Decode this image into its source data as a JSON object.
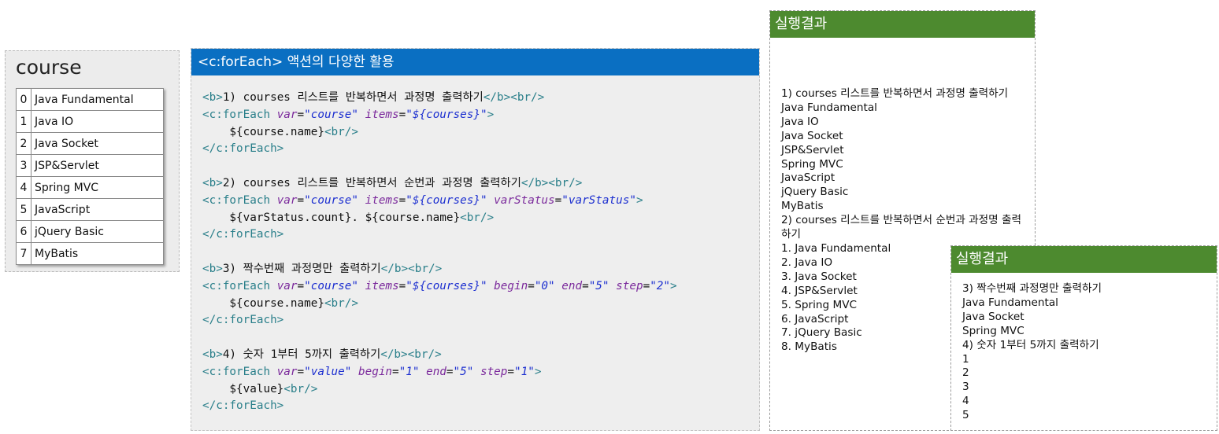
{
  "course_panel": {
    "title": "course",
    "rows": [
      {
        "index": "0",
        "name": "Java Fundamental"
      },
      {
        "index": "1",
        "name": "Java IO"
      },
      {
        "index": "2",
        "name": "Java Socket"
      },
      {
        "index": "3",
        "name": "JSP&Servlet"
      },
      {
        "index": "4",
        "name": "Spring MVC"
      },
      {
        "index": "5",
        "name": "JavaScript"
      },
      {
        "index": "6",
        "name": "jQuery Basic"
      },
      {
        "index": "7",
        "name": "MyBatis"
      }
    ]
  },
  "code_panel": {
    "title": "<c:forEach> 액션의 다양한 활용",
    "lines": [
      [
        [
          "tg",
          "<b>"
        ],
        [
          "tx",
          "1) courses 리스트를 반복하면서 과정명 출력하기"
        ],
        [
          "tg",
          "</b><br/>"
        ]
      ],
      [
        [
          "kw",
          "<c:forEach "
        ],
        [
          "at",
          "var"
        ],
        [
          "tx",
          "="
        ],
        [
          "vl",
          "\"course\""
        ],
        [
          "tx",
          " "
        ],
        [
          "at",
          "items"
        ],
        [
          "tx",
          "="
        ],
        [
          "vl",
          "\"${courses}\""
        ],
        [
          "kw",
          ">"
        ]
      ],
      [
        [
          "tx",
          "    ${course.name}"
        ],
        [
          "tg",
          "<br/>"
        ]
      ],
      [
        [
          "kw",
          "</c:forEach>"
        ]
      ],
      [],
      [
        [
          "tg",
          "<b>"
        ],
        [
          "tx",
          "2) courses 리스트를 반복하면서 순번과 과정명 출력하기"
        ],
        [
          "tg",
          "</b><br/>"
        ]
      ],
      [
        [
          "kw",
          "<c:forEach "
        ],
        [
          "at",
          "var"
        ],
        [
          "tx",
          "="
        ],
        [
          "vl",
          "\"course\""
        ],
        [
          "tx",
          " "
        ],
        [
          "at",
          "items"
        ],
        [
          "tx",
          "="
        ],
        [
          "vl",
          "\"${courses}\""
        ],
        [
          "tx",
          " "
        ],
        [
          "at",
          "varStatus"
        ],
        [
          "tx",
          "="
        ],
        [
          "vl",
          "\"varStatus\""
        ],
        [
          "kw",
          ">"
        ]
      ],
      [
        [
          "tx",
          "    ${varStatus.count}. ${course.name}"
        ],
        [
          "tg",
          "<br/>"
        ]
      ],
      [
        [
          "kw",
          "</c:forEach>"
        ]
      ],
      [],
      [
        [
          "tg",
          "<b>"
        ],
        [
          "tx",
          "3) 짝수번째 과정명만 출력하기"
        ],
        [
          "tg",
          "</b><br/>"
        ]
      ],
      [
        [
          "kw",
          "<c:forEach "
        ],
        [
          "at",
          "var"
        ],
        [
          "tx",
          "="
        ],
        [
          "vl",
          "\"course\""
        ],
        [
          "tx",
          " "
        ],
        [
          "at",
          "items"
        ],
        [
          "tx",
          "="
        ],
        [
          "vl",
          "\"${courses}\""
        ],
        [
          "tx",
          " "
        ],
        [
          "at",
          "begin"
        ],
        [
          "tx",
          "="
        ],
        [
          "vl",
          "\"0\""
        ],
        [
          "tx",
          " "
        ],
        [
          "at",
          "end"
        ],
        [
          "tx",
          "="
        ],
        [
          "vl",
          "\"5\""
        ],
        [
          "tx",
          " "
        ],
        [
          "at",
          "step"
        ],
        [
          "tx",
          "="
        ],
        [
          "vl",
          "\"2\""
        ],
        [
          "kw",
          ">"
        ]
      ],
      [
        [
          "tx",
          "    ${course.name}"
        ],
        [
          "tg",
          "<br/>"
        ]
      ],
      [
        [
          "kw",
          "</c:forEach>"
        ]
      ],
      [],
      [
        [
          "tg",
          "<b>"
        ],
        [
          "tx",
          "4) 숫자 1부터 5까지 출력하기"
        ],
        [
          "tg",
          "</b><br/>"
        ]
      ],
      [
        [
          "kw",
          "<c:forEach "
        ],
        [
          "at",
          "var"
        ],
        [
          "tx",
          "="
        ],
        [
          "vl",
          "\"value\""
        ],
        [
          "tx",
          " "
        ],
        [
          "at",
          "begin"
        ],
        [
          "tx",
          "="
        ],
        [
          "vl",
          "\"1\""
        ],
        [
          "tx",
          " "
        ],
        [
          "at",
          "end"
        ],
        [
          "tx",
          "="
        ],
        [
          "vl",
          "\"5\""
        ],
        [
          "tx",
          " "
        ],
        [
          "at",
          "step"
        ],
        [
          "tx",
          "="
        ],
        [
          "vl",
          "\"1\""
        ],
        [
          "kw",
          ">"
        ]
      ],
      [
        [
          "tx",
          "    ${value}"
        ],
        [
          "tg",
          "<br/>"
        ]
      ],
      [
        [
          "kw",
          "</c:forEach>"
        ]
      ]
    ]
  },
  "result_panel_1": {
    "title": "실행결과",
    "lines": [
      "1) courses 리스트를 반복하면서 과정명 출력하기",
      "Java Fundamental",
      "Java IO",
      "Java Socket",
      "JSP&Servlet",
      "Spring MVC",
      "JavaScript",
      "jQuery Basic",
      "MyBatis",
      "2) courses 리스트를 반복하면서 순번과 과정명 출력하기",
      "1. Java Fundamental",
      "2. Java IO",
      "3. Java Socket",
      "4. JSP&Servlet",
      "5. Spring MVC",
      "6. JavaScript",
      "7. jQuery Basic",
      "8. MyBatis"
    ]
  },
  "result_panel_2": {
    "title": "실행결과",
    "lines": [
      "3) 짝수번째 과정명만 출력하기",
      "Java Fundamental",
      "Java Socket",
      "Spring MVC",
      "4) 숫자 1부터 5까지 출력하기",
      "1",
      "2",
      "3",
      "4",
      "5"
    ]
  },
  "colors": {
    "code_header_bg": "#0a6fc2",
    "result_header_bg": "#4d8a2f",
    "tag_color": "#2a7f8a",
    "attr_color": "#7b2a9c",
    "value_color": "#1c2fd0"
  }
}
